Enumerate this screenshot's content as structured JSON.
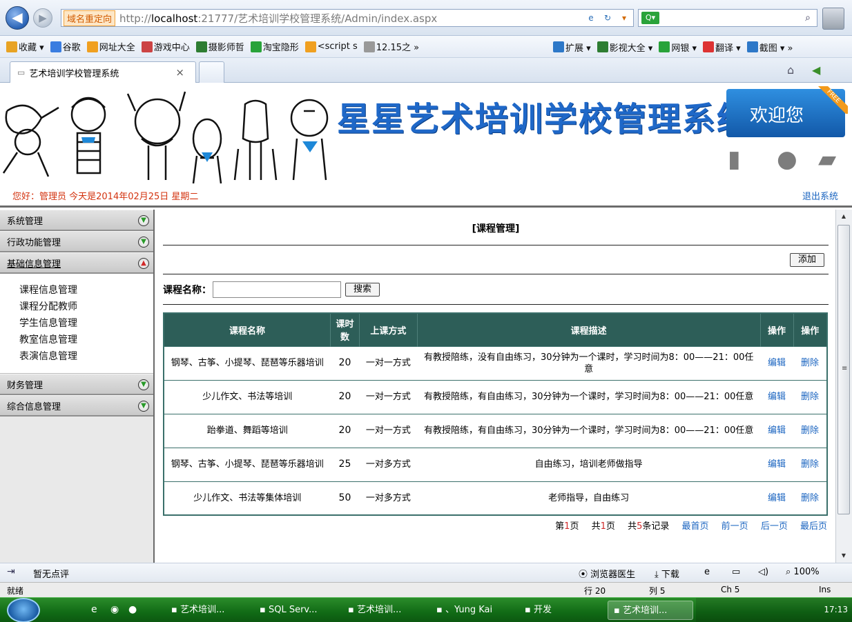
{
  "browser": {
    "redirect_label": "域名重定向",
    "url_host": "localhost",
    "url_prefix": "http://",
    "url_rest": ":21777/艺术培训学校管理系统/Admin/index.aspx",
    "favorites": [
      {
        "label": "收藏 ▾",
        "icon": "star-icon",
        "color": "#e8a323"
      },
      {
        "label": "谷歌",
        "icon": "google-icon",
        "color": "#3a7de0"
      },
      {
        "label": "网址大全",
        "icon": "site-icon",
        "color": "#f0a020"
      },
      {
        "label": "游戏中心",
        "icon": "game-icon",
        "color": "#c44"
      },
      {
        "label": "摄影师哲",
        "icon": "douban-icon",
        "color": "#2e7d32"
      },
      {
        "label": "淘宝隐形",
        "icon": "taobao-icon",
        "color": "#29a33a"
      },
      {
        "label": "<script s",
        "icon": "site-icon",
        "color": "#f0a020"
      },
      {
        "label": "12.15之 »",
        "icon": "page-icon",
        "color": "#999"
      }
    ],
    "favorites_right": [
      {
        "label": "扩展 ▾",
        "icon": "extension-icon",
        "color": "#2d78c8"
      },
      {
        "label": "影视大全 ▾",
        "icon": "video-icon",
        "color": "#2e7d32"
      },
      {
        "label": "网银 ▾",
        "icon": "bank-icon",
        "color": "#29a33a"
      },
      {
        "label": "翻译 ▾",
        "icon": "translate-icon",
        "color": "#d33"
      },
      {
        "label": "截图 ▾ »",
        "icon": "screenshot-icon",
        "color": "#2d78c8"
      }
    ],
    "tab_title": "艺术培训学校管理系统",
    "tab_close": "×"
  },
  "header": {
    "site_title": "星星艺术培训学校管理系统",
    "welcome": "欢迎您",
    "badge": "FREE",
    "greeting": "您好：管理员   今天是2014年02月25日  星期二",
    "logout": "退出系统"
  },
  "menu": {
    "sections": [
      {
        "label": "系统管理",
        "open": false
      },
      {
        "label": "行政功能管理",
        "open": false
      },
      {
        "label": "基础信息管理",
        "open": true
      }
    ],
    "sub_items": [
      "课程信息管理",
      "课程分配教师",
      "学生信息管理",
      "教室信息管理",
      "表演信息管理"
    ],
    "sections_after": [
      {
        "label": "财务管理",
        "open": false
      },
      {
        "label": "综合信息管理",
        "open": false
      }
    ]
  },
  "main": {
    "heading": "[课程管理]",
    "add_label": "添加",
    "search_label": "课程名称：",
    "search_value": "",
    "search_button": "搜索",
    "columns": [
      "课程名称",
      "课时数",
      "上课方式",
      "课程描述",
      "操作",
      "操作"
    ],
    "rows": [
      {
        "name": "钢琴、古筝、小提琴、琵琶等乐器培训",
        "hours": "20",
        "mode": "一对一方式",
        "desc": "有教授陪练，没有自由练习，30分钟为一个课时，学习时间为8：00——21：00任意",
        "edit": "编辑",
        "del": "删除"
      },
      {
        "name": "少儿作文、书法等培训",
        "hours": "20",
        "mode": "一对一方式",
        "desc": "有教授陪练，有自由练习，30分钟为一个课时，学习时间为8：00——21：00任意",
        "edit": "编辑",
        "del": "删除"
      },
      {
        "name": "跆拳道、舞蹈等培训",
        "hours": "20",
        "mode": "一对一方式",
        "desc": "有教授陪练，有自由练习，30分钟为一个课时，学习时间为8：00——21：00任意",
        "edit": "编辑",
        "del": "删除"
      },
      {
        "name": "钢琴、古筝、小提琴、琵琶等乐器培训",
        "hours": "25",
        "mode": "一对多方式",
        "desc": "自由练习，培训老师做指导",
        "edit": "编辑",
        "del": "删除"
      },
      {
        "name": "少儿作文、书法等集体培训",
        "hours": "50",
        "mode": "一对多方式",
        "desc": "老师指导，自由练习",
        "edit": "编辑",
        "del": "删除"
      }
    ],
    "pager": {
      "page_prefix": "第",
      "page_num": "1",
      "page_suffix": "页",
      "total_prefix": "共",
      "total_pages": "1",
      "total_suffix": "页",
      "records_prefix": "共",
      "records": "5",
      "records_suffix": "条记录",
      "first": "最首页",
      "prev": "前一页",
      "next": "后一页",
      "last": "最后页"
    }
  },
  "infobar": {
    "review": "暂无点评",
    "doctor": "浏览器医生",
    "download": "下载",
    "zoom": "100%"
  },
  "statusbar": {
    "ready": "就绪",
    "row": "行 20",
    "col": "列 5",
    "ch": "Ch 5",
    "ins": "Ins"
  },
  "taskbar": {
    "tasks": [
      "艺术培训...",
      "SQL Serv...",
      "艺术培训...",
      "、Yung Kai",
      "开发",
      "艺术培训..."
    ],
    "time": "17:13"
  }
}
